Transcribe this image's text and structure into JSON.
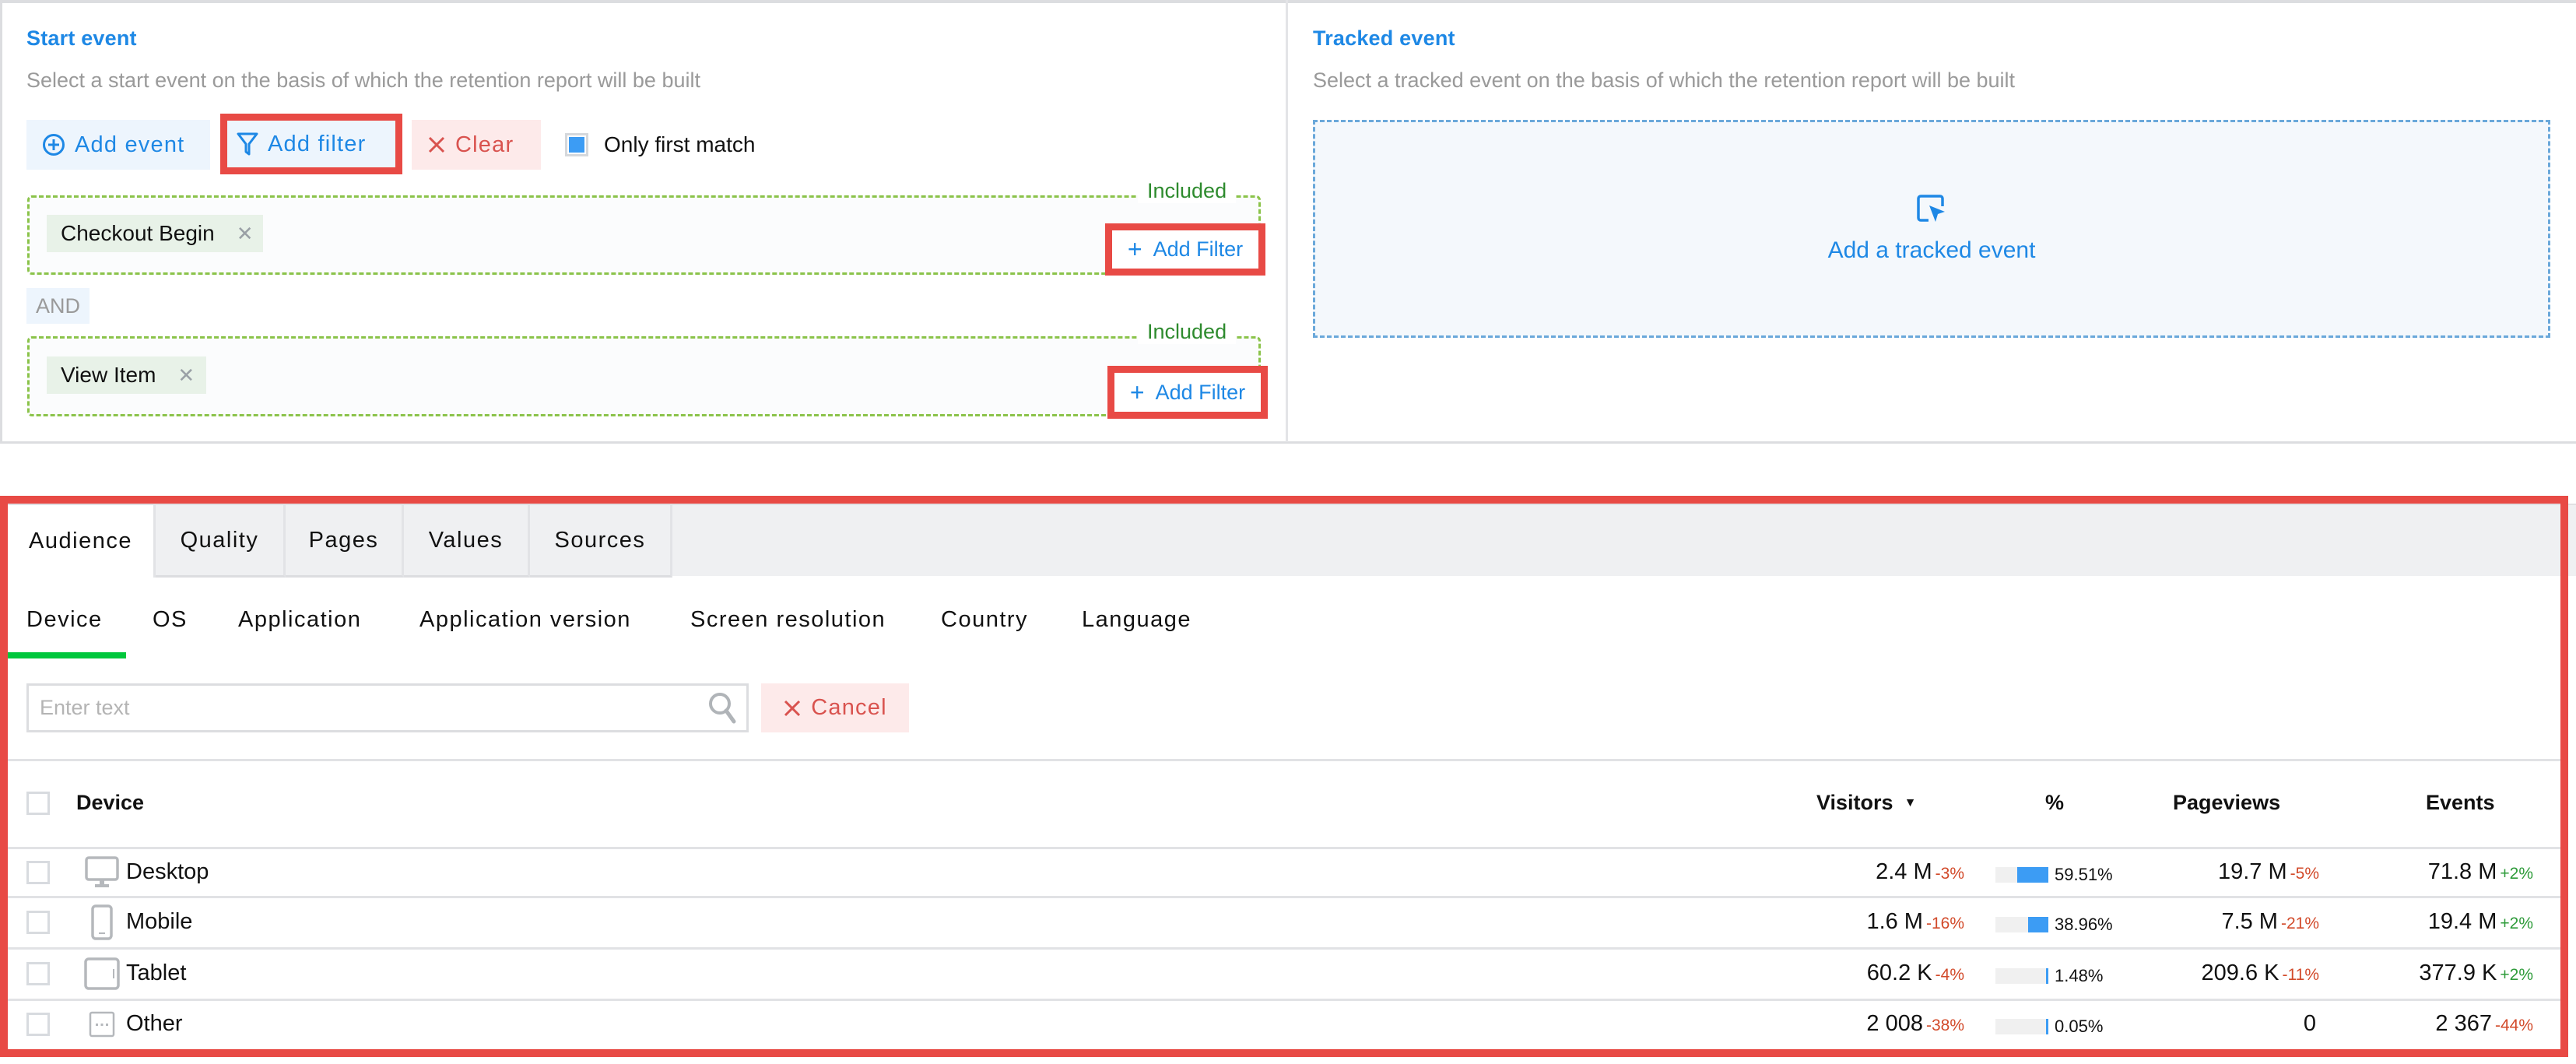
{
  "start_event": {
    "title": "Start event",
    "subtitle": "Select a start event on the basis of which the retention report will be built",
    "buttons": {
      "add_event": "Add event",
      "add_filter": "Add filter",
      "clear": "Clear"
    },
    "only_first_match": {
      "label": "Only first match",
      "checked": true
    },
    "groups": [
      {
        "status": "Included",
        "event": "Checkout Begin",
        "add_filter_label": "Add Filter"
      },
      {
        "status": "Included",
        "event": "View Item",
        "add_filter_label": "Add Filter"
      }
    ],
    "connector": "AND"
  },
  "tracked_event": {
    "title": "Tracked event",
    "subtitle": "Select a tracked event on the basis of which the retention report will be built",
    "add_label": "Add a tracked event"
  },
  "report": {
    "tabs": [
      {
        "label": "Audience",
        "active": true
      },
      {
        "label": "Quality",
        "active": false
      },
      {
        "label": "Pages",
        "active": false
      },
      {
        "label": "Values",
        "active": false
      },
      {
        "label": "Sources",
        "active": false
      }
    ],
    "subtabs": [
      {
        "label": "Device",
        "active": true
      },
      {
        "label": "OS",
        "active": false
      },
      {
        "label": "Application",
        "active": false
      },
      {
        "label": "Application version",
        "active": false
      },
      {
        "label": "Screen resolution",
        "active": false
      },
      {
        "label": "Country",
        "active": false
      },
      {
        "label": "Language",
        "active": false
      }
    ],
    "search": {
      "placeholder": "Enter text",
      "value": ""
    },
    "cancel_label": "Cancel",
    "table": {
      "columns": {
        "device": "Device",
        "visitors": "Visitors",
        "visitors_sort": "▼",
        "percent": "%",
        "pageviews": "Pageviews",
        "events": "Events"
      },
      "rows": [
        {
          "device": "Desktop",
          "icon": "desktop-icon",
          "visitors": "2.4 M",
          "visitors_delta": "-3%",
          "percent": "59.51%",
          "percent_value": 59.51,
          "pageviews": "19.7 M",
          "pageviews_delta": "-5%",
          "events": "71.8 M",
          "events_delta": "+2%"
        },
        {
          "device": "Mobile",
          "icon": "mobile-icon",
          "visitors": "1.6 M",
          "visitors_delta": "-16%",
          "percent": "38.96%",
          "percent_value": 38.96,
          "pageviews": "7.5 M",
          "pageviews_delta": "-21%",
          "events": "19.4 M",
          "events_delta": "+2%"
        },
        {
          "device": "Tablet",
          "icon": "tablet-icon",
          "visitors": "60.2 K",
          "visitors_delta": "-4%",
          "percent": "1.48%",
          "percent_value": 1.48,
          "pageviews": "209.6 K",
          "pageviews_delta": "-11%",
          "events": "377.9 K",
          "events_delta": "+2%"
        },
        {
          "device": "Other",
          "icon": "other-device-icon",
          "visitors": "2 008",
          "visitors_delta": "-38%",
          "percent": "0.05%",
          "percent_value": 0.05,
          "pageviews": "0",
          "pageviews_delta": "",
          "events": "2 367",
          "events_delta": "-44%"
        }
      ]
    }
  },
  "colors": {
    "accent_blue": "#1e88e5",
    "highlight_red": "#e84a45",
    "included_green": "#2e8b2e",
    "active_underline": "#00c73c",
    "negative": "#d24a2a",
    "positive": "#2e9b3a",
    "bar_fill": "#3c9cf4"
  }
}
